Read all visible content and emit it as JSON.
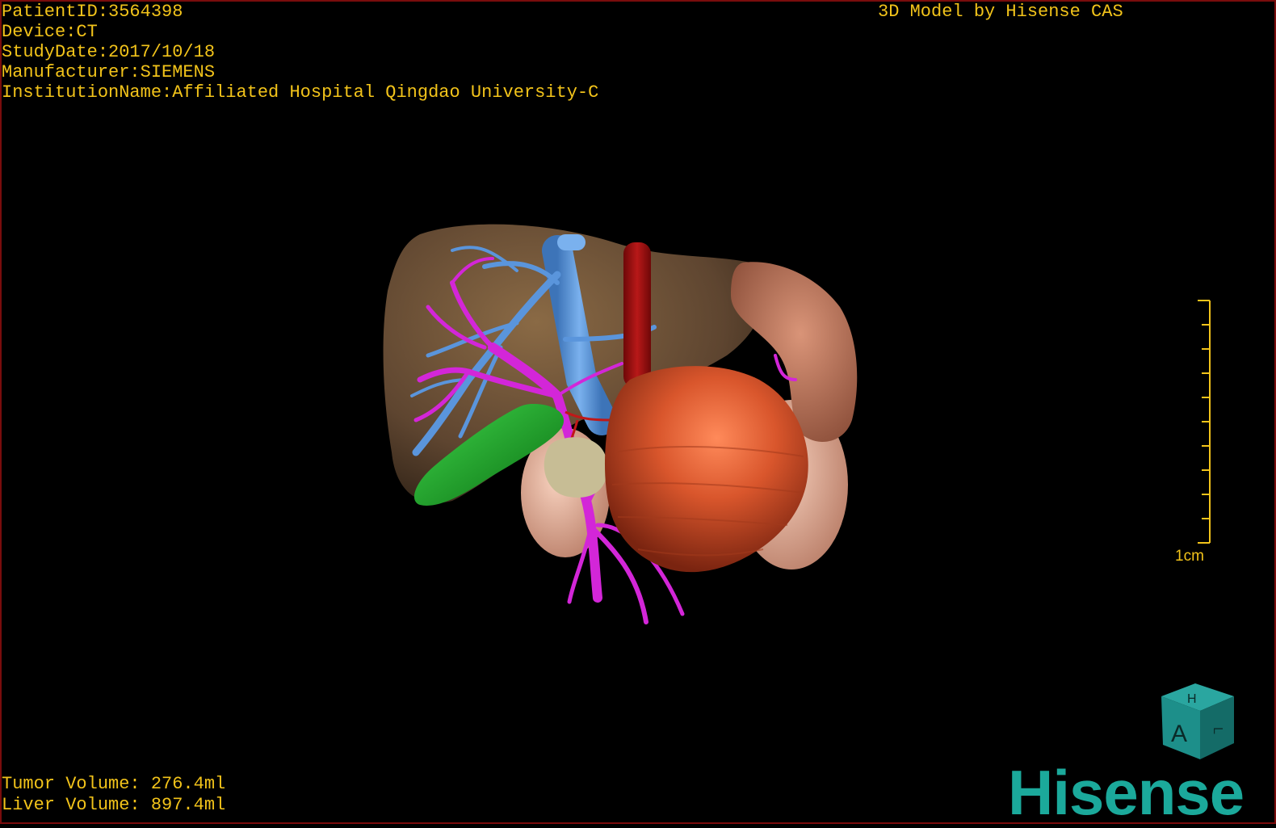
{
  "patient_info": {
    "patient_id": "PatientID:3564398",
    "device": "Device:CT",
    "study_date": "StudyDate:2017/10/18",
    "manufacturer": "Manufacturer:SIEMENS",
    "institution": "InstitutionName:Affiliated Hospital Qingdao University-C"
  },
  "model_credit": "3D Model by Hisense CAS",
  "volumes": {
    "tumor": "Tumor Volume: 276.4ml",
    "liver": "Liver Volume: 897.4ml"
  },
  "scale_bar": {
    "label": "1cm"
  },
  "orientation_cube": {
    "front_letter": "A",
    "top_letter": "H",
    "side_letter": "L"
  },
  "logo_text": "Hisense",
  "colors": {
    "overlay_text": "#f2c31a",
    "liver": "#6b5135",
    "tumor": "#d0502a",
    "portal_vein": "#d326d8",
    "hepatic_vein": "#4f8fd6",
    "aorta": "#a01010",
    "gallbladder": "#16a020",
    "kidney": "#e9b19a",
    "spleen": "#c27c62",
    "logo": "#1ba99b"
  }
}
